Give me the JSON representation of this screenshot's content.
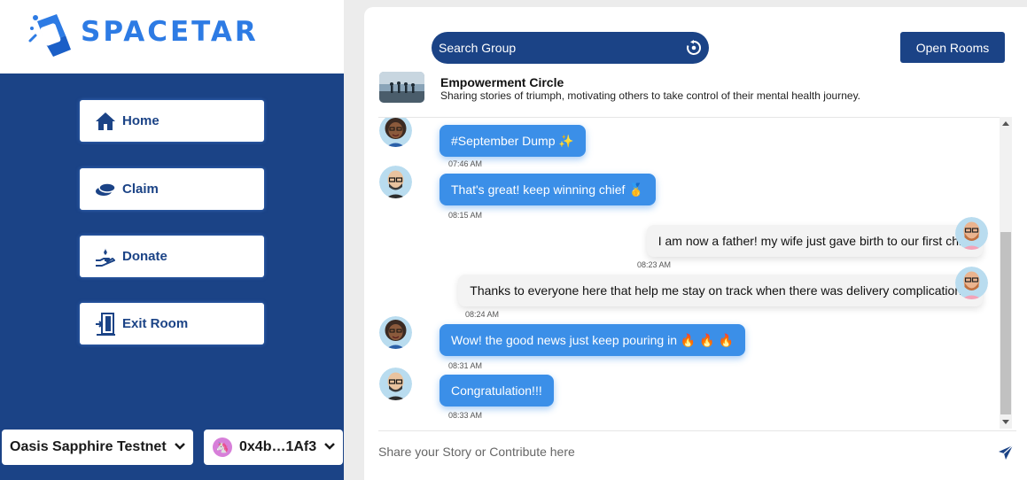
{
  "app": {
    "name": "SPACETAR",
    "brand_color": "#1b4386",
    "accent_color": "#3b8fe8"
  },
  "nav": [
    {
      "label": "Home",
      "icon": "home-icon"
    },
    {
      "label": "Claim",
      "icon": "coins-icon"
    },
    {
      "label": "Donate",
      "icon": "donate-hand-icon"
    },
    {
      "label": "Exit Room",
      "icon": "exit-door-icon"
    }
  ],
  "network": {
    "label": "Oasis Sapphire Testnet"
  },
  "wallet": {
    "address": "0x4b…1Af3"
  },
  "search": {
    "placeholder": "Search Group"
  },
  "open_rooms": "Open Rooms",
  "group": {
    "name": "Empowerment Circle",
    "description": "Sharing stories of triumph, motivating others to take control of their mental health journey."
  },
  "messages": [
    {
      "text": "#September Dump ✨",
      "time": "07:46 AM",
      "direction": "incoming",
      "avatar": "woman-avatar"
    },
    {
      "text": "That's great! keep winning chief 🥇",
      "time": "08:15 AM",
      "direction": "incoming",
      "avatar": "bald-man-avatar"
    },
    {
      "text": "I am now a father! my wife just gave birth to our first child",
      "time": "08:23 AM",
      "direction": "outgoing",
      "avatar": "bearded-man-avatar"
    },
    {
      "text": "Thanks to everyone here that help me stay on track when there was delivery complications.",
      "time": "08:24 AM",
      "direction": "outgoing",
      "avatar": "bearded-man-avatar"
    },
    {
      "text": "Wow! the good news just keep pouring in 🔥 🔥 🔥",
      "time": "08:31 AM",
      "direction": "incoming",
      "avatar": "woman-avatar"
    },
    {
      "text": "Congratulation!!!",
      "time": "08:33 AM",
      "direction": "incoming",
      "avatar": "bald-man-avatar"
    }
  ],
  "composer": {
    "placeholder": "Share your Story or Contribute here"
  }
}
